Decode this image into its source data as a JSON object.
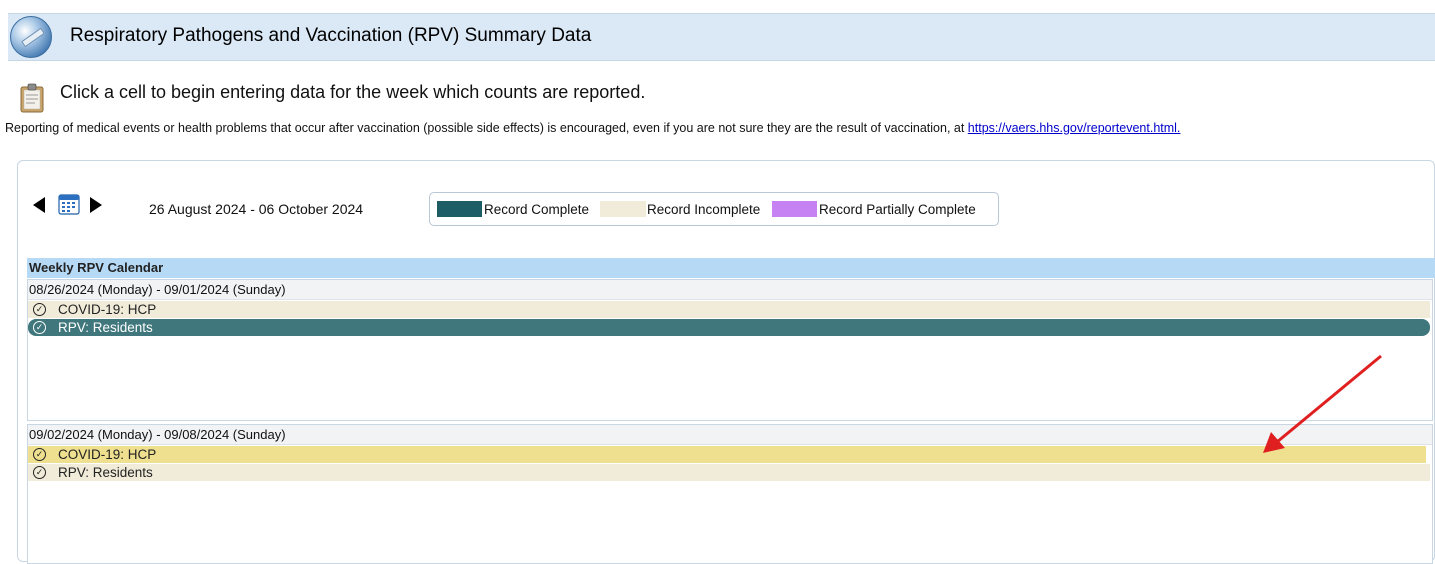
{
  "header": {
    "title": "Respiratory Pathogens and Vaccination (RPV) Summary Data",
    "logo_icon": "vaccination-logo-icon"
  },
  "instructions": {
    "icon": "clipboard-icon",
    "text": "Click a cell to begin entering data for the week which counts are reported."
  },
  "vaers": {
    "text": "Reporting of medical events or health problems that occur after vaccination (possible side effects) is encouraged, even if you are not sure they are the result of vaccination, at ",
    "link_text": "https://vaers.hhs.gov/reportevent.html."
  },
  "calendar_nav": {
    "prev_icon": "triangle-left-icon",
    "calendar_icon": "calendar-icon",
    "next_icon": "triangle-right-icon",
    "date_range": "26 August 2024  -  06 October 2024"
  },
  "legend": [
    {
      "label": "Record Complete",
      "color": "#1d5d66"
    },
    {
      "label": "Record Incomplete",
      "color": "#f1ecd9"
    },
    {
      "label": "Record Partially Complete",
      "color": "#c681f2"
    }
  ],
  "calendar": {
    "header": "Weekly RPV Calendar",
    "weeks": [
      {
        "label": "08/26/2024 (Monday) - 09/01/2024 (Sunday)",
        "records": [
          {
            "label": "COVID-19: HCP",
            "status": "incomplete"
          },
          {
            "label": "RPV: Residents",
            "status": "complete"
          }
        ]
      },
      {
        "label": "09/02/2024 (Monday) - 09/08/2024 (Sunday)",
        "records": [
          {
            "label": "COVID-19: HCP",
            "status": "highlighted"
          },
          {
            "label": "RPV: Residents",
            "status": "incomplete"
          }
        ]
      }
    ]
  },
  "colors": {
    "header_bg": "#dbe9f7",
    "calendar_header_bg": "#b6d9f6",
    "complete": "#3f777c",
    "incomplete": "#f1ecd9",
    "highlight": "#eee08f",
    "annotation_arrow": "#e02020"
  }
}
